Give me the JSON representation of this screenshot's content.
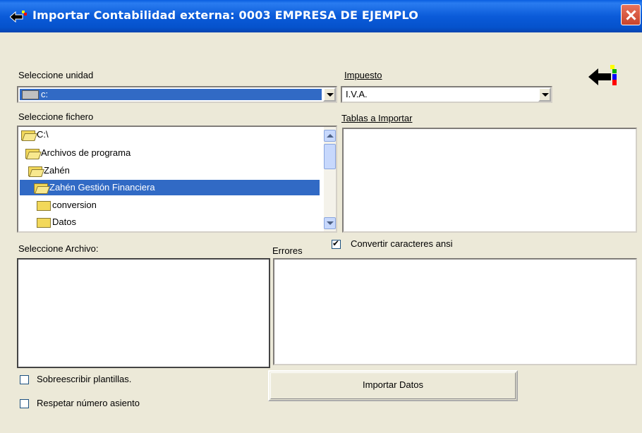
{
  "window": {
    "title": "Importar Contabilidad externa: 0003 EMPRESA DE EJEMPLO"
  },
  "unidad": {
    "label": "Seleccione unidad",
    "value": "c:"
  },
  "impuesto": {
    "label": "Impuesto",
    "value": "I.V.A."
  },
  "fichero": {
    "label": "Seleccione fichero",
    "items": [
      "C:\\",
      "Archivos de programa",
      "Zahén",
      "Zahén Gestión Financiera",
      "conversion",
      "Datos"
    ]
  },
  "tablas": {
    "label": "Tablas a Importar"
  },
  "archivo": {
    "label": "Seleccione Archivo:"
  },
  "errores": {
    "label": "Errores"
  },
  "options": {
    "convertir": "Convertir caracteres ansi",
    "sobreescribir": "Sobreescribir plantillas.",
    "respetar": "Respetar número asiento"
  },
  "buttons": {
    "importar": "Importar Datos"
  },
  "colors": {
    "titlebar": "#0552cc",
    "selection": "#316ac5",
    "close": "#c8442c"
  }
}
